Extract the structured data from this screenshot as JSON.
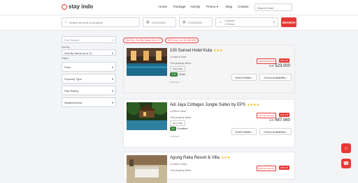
{
  "nav": {
    "logo": "stay indo",
    "menu": [
      "Home",
      "Package",
      "Activity",
      "Promo",
      "Blog",
      "Contact"
    ],
    "search_placeholder": "Search Hotel"
  },
  "search": {
    "destination_placeholder": "Search an area or property",
    "checkin": "07/02/2026",
    "checkout": "07/03/2026",
    "guests_line1": "2 Adults",
    "guests_line2": "1 Room",
    "button": "SEARCH"
  },
  "sidebar": {
    "search_placeholder": "Sort Search",
    "sort_label": "Sort By",
    "sort_value": "Sort By Name (A to Z)",
    "filters_label": "Filters",
    "filters": [
      "Price",
      "Property Type",
      "Star Rating",
      "Neighborhood"
    ]
  },
  "tags": [
    "Sort By : Sort By Name (A to Z)",
    "IDR From 0 to 10.000.000"
  ],
  "hotels": [
    {
      "name": "100 Sunset Hotel Kuta",
      "stars": "★★★",
      "location": "Hotel in Kuta",
      "offers": "This property offers:",
      "show_map": "Show Map",
      "score": "4.50",
      "score_label": "Great",
      "reviews": "5 Reviews",
      "special": "Special Discount",
      "discount": "38% Off",
      "currency": "IDR",
      "price": "523.000",
      "details_btn": "Hotel Details",
      "avail_btn": "Check Availability"
    },
    {
      "name": "Adi Jaya Cottages Jungle Suites by EPS",
      "stars": "★★★★",
      "location": "Villa in Ubud",
      "offers": "This property offers:",
      "show_map": "Show Map",
      "score": "5.0",
      "score_label": "Excellent",
      "reviews": "1 Reviews",
      "special": "Special Discount",
      "discount": "30% Off",
      "currency": "IDR",
      "price": "487.060",
      "details_btn": "Hotel Details",
      "avail_btn": "Check Availability"
    },
    {
      "name": "Agung Raka Resort & Villa",
      "stars": "★★★",
      "location": "Hotel in Ubud",
      "offers": "This property offers:",
      "special": "Special Discount",
      "discount": "30% Off"
    }
  ],
  "fab": {
    "top_icon": "hotel-icon",
    "bottom_icon": "support-icon"
  },
  "colors": {
    "accent": "#e53935",
    "star": "#f4b400",
    "score": "#2e7d32"
  }
}
